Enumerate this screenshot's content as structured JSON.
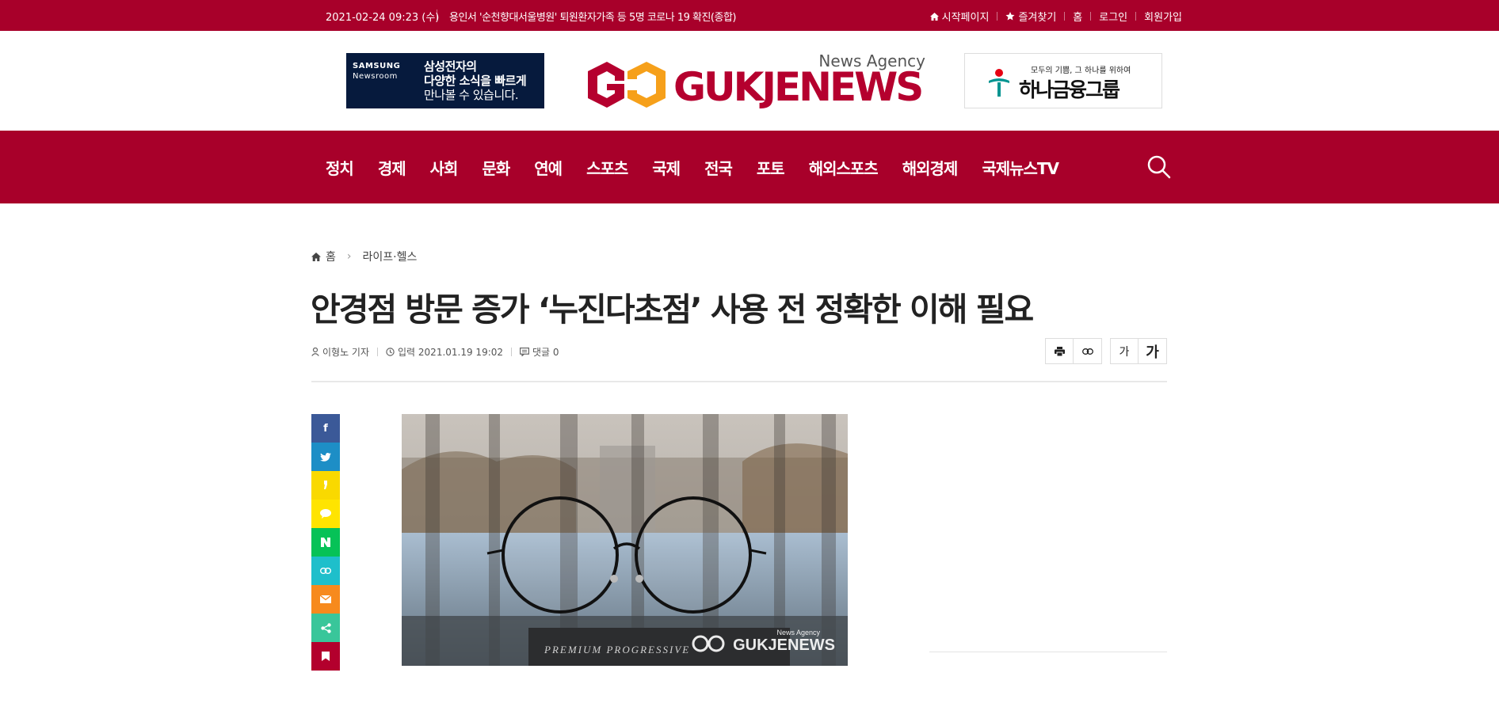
{
  "topbar": {
    "date": "2021-02-24 09:23 (수)",
    "ticker": "용인서 '순천향대서울병원' 퇴원환자가족 등 5명 코로나 19 확진(종합)",
    "links": [
      "시작페이지",
      "즐겨찾기",
      "홈",
      "로그인",
      "회원가입"
    ]
  },
  "header": {
    "ad_left_brand_1": "SAMSUNG",
    "ad_left_brand_2": "Newsroom",
    "ad_left_line1": "삼성전자의",
    "ad_left_line2": "다양한 소식을 빠르게",
    "ad_left_line3": "만나볼 수 있습니다.",
    "logo_agency": "News Agency",
    "logo_word": "GUKJENEWS",
    "ad_right_slogan": "모두의 기쁨, 그 하나를 위하여",
    "ad_right_name": "하나금융그룹"
  },
  "nav": {
    "items": [
      "정치",
      "경제",
      "사회",
      "문화",
      "연예",
      "스포츠",
      "국제",
      "전국",
      "포토",
      "해외스포츠",
      "해외경제",
      "국제뉴스TV"
    ]
  },
  "breadcrumb": {
    "home": "홈",
    "section": "라이프·헬스"
  },
  "article": {
    "headline": "안경점 방문 증가 ‘누진다초점’ 사용 전 정확한 이해 필요",
    "reporter": "이형노 기자",
    "published": "입력 2021.01.19 19:02",
    "comments": "댓글 0",
    "font_small": "가",
    "font_large": "가"
  },
  "photo": {
    "card_text": "PREMIUM PROGRESSIVE",
    "watermark_agency": "News Agency",
    "watermark_word": "GUKJENEWS"
  },
  "colors": {
    "brand": "#a8002a",
    "facebook": "#3b5998",
    "twitter": "#1da1f2",
    "kakaostory": "#f9d900",
    "kakaotalk": "#ffe400",
    "naverband": "#06c257",
    "link": "#1ebfcb",
    "email": "#f78a1d",
    "share": "#39c69a",
    "bookmark": "#b3002d"
  },
  "icons": {
    "share": [
      "facebook-icon",
      "twitter-icon",
      "kakaostory-icon",
      "kakaotalk-icon",
      "naverband-icon",
      "link-icon",
      "email-icon",
      "share-icon",
      "bookmark-icon"
    ]
  }
}
